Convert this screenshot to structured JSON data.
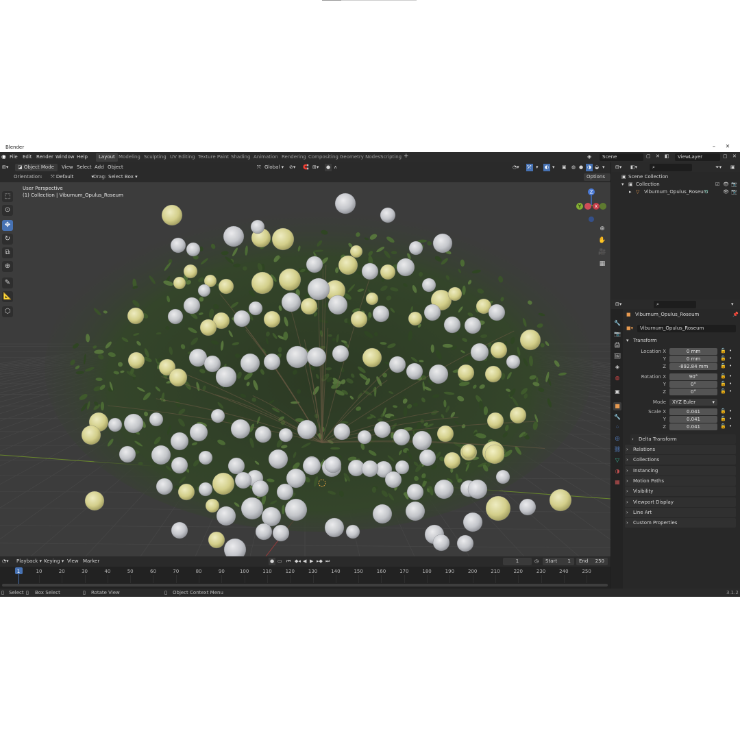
{
  "window": {
    "title": "Blender"
  },
  "menu": {
    "items": [
      "File",
      "Edit",
      "Render",
      "Window",
      "Help"
    ],
    "workspaces": [
      "Layout",
      "Modeling",
      "Sculpting",
      "UV Editing",
      "Texture Paint",
      "Shading",
      "Animation",
      "Rendering",
      "Compositing",
      "Geometry Nodes",
      "Scripting"
    ],
    "active_workspace": "Layout",
    "add_workspace": "+",
    "scene": "Scene",
    "view_layer": "ViewLayer"
  },
  "viewport_header": {
    "mode": "Object Mode",
    "menus": [
      "View",
      "Select",
      "Add",
      "Object"
    ],
    "transform_space": "Global",
    "orientation_label": "Orientation:",
    "orientation_value": "Default",
    "drag_label": "Drag:",
    "drag_value": "Select Box",
    "options": "Options"
  },
  "viewport": {
    "perspective": "User Perspective",
    "collection_info": "(1) Collection | Viburnum_Opulus_Roseum",
    "gizmo": {
      "z": "Z",
      "y": "Y",
      "x": "X"
    }
  },
  "outliner": {
    "scene_collection": "Scene Collection",
    "collection": "Collection",
    "object": "Viburnum_Opulus_Roseum"
  },
  "properties": {
    "object_name": "Viburnum_Opulus_Roseum",
    "object_field": "Viburnum_Opulus_Roseum",
    "transform_title": "Transform",
    "location_label": "Location X",
    "location": [
      "0 mm",
      "0 mm",
      "-892.84 mm"
    ],
    "rotation_label": "Rotation X",
    "rotation": [
      "90°",
      "0°",
      "0°"
    ],
    "mode_label": "Mode",
    "mode_value": "XYZ Euler",
    "scale_label": "Scale X",
    "scale": [
      "0.041",
      "0.041",
      "0.041"
    ],
    "axis_y": "Y",
    "axis_z": "Z",
    "delta_transform": "Delta Transform",
    "panels": [
      "Relations",
      "Collections",
      "Instancing",
      "Motion Paths",
      "Visibility",
      "Viewport Display",
      "Line Art",
      "Custom Properties"
    ]
  },
  "timeline": {
    "menus": [
      "Playback",
      "Keying",
      "View",
      "Marker"
    ],
    "current_frame": "1",
    "start_label": "Start",
    "start": "1",
    "end_label": "End",
    "end": "250",
    "ticks": [
      "1",
      "10",
      "20",
      "30",
      "40",
      "50",
      "60",
      "70",
      "80",
      "90",
      "100",
      "110",
      "120",
      "130",
      "140",
      "150",
      "160",
      "170",
      "180",
      "190",
      "200",
      "210",
      "220",
      "230",
      "240",
      "250"
    ]
  },
  "statusbar": {
    "select": "Select",
    "box_select": "Box Select",
    "rotate_view": "Rotate View",
    "context_menu": "Object Context Menu",
    "version": "3.1.2"
  }
}
